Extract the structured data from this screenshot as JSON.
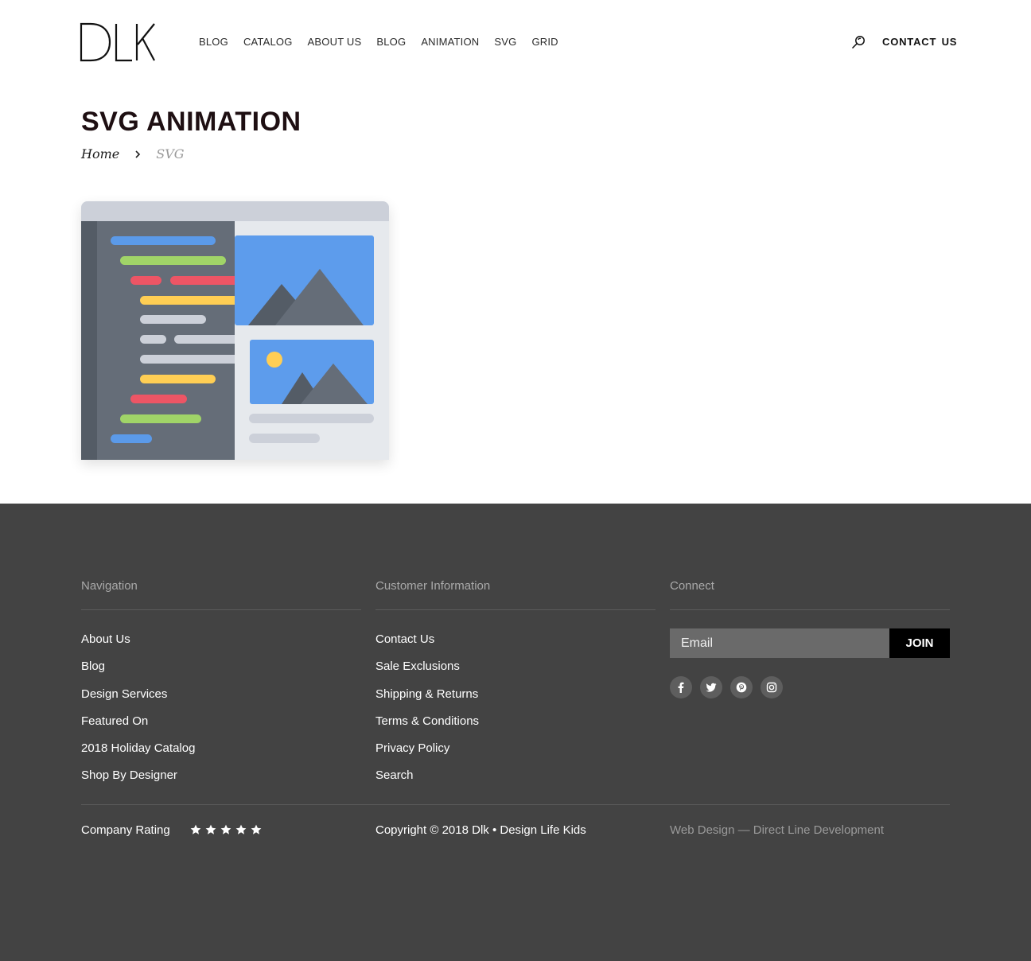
{
  "header": {
    "logo_text": "DLK",
    "nav": [
      "BLOG",
      "CATALOG",
      "ABOUT US",
      "BLOG",
      "ANIMATION",
      "SVG",
      "GRID"
    ],
    "contact_label": "CONTACT US"
  },
  "page": {
    "title": "SVG ANIMATION",
    "breadcrumb": {
      "home": "Home",
      "current": "SVG"
    }
  },
  "footer": {
    "navigation": {
      "heading": "Navigation",
      "links": [
        "About Us",
        "Blog",
        "Design Services",
        "Featured On",
        "2018 Holiday Catalog",
        "Shop By Designer"
      ]
    },
    "customer_info": {
      "heading": "Customer Information",
      "links": [
        "Contact Us",
        "Sale Exclusions",
        "Shipping & Returns",
        "Terms & Conditions",
        "Privacy Policy",
        "Search"
      ]
    },
    "connect": {
      "heading": "Connect",
      "email_placeholder": "Email",
      "join_label": "JOIN",
      "socials": [
        "facebook-icon",
        "twitter-icon",
        "pinterest-icon",
        "instagram-icon"
      ]
    },
    "rating_label": "Company Rating",
    "rating": 5,
    "copyright": "Copyright © 2018 Dlk • Design Life Kids",
    "credit": "Web Design — Direct Line Development"
  },
  "colors": {
    "footer_bg": "#434343",
    "title": "#1e0f12",
    "code_blue": "#5b9ae9",
    "code_green": "#a0d468",
    "code_red": "#ed5565",
    "code_yellow": "#ffce54",
    "code_gray": "#ccd0d9"
  }
}
